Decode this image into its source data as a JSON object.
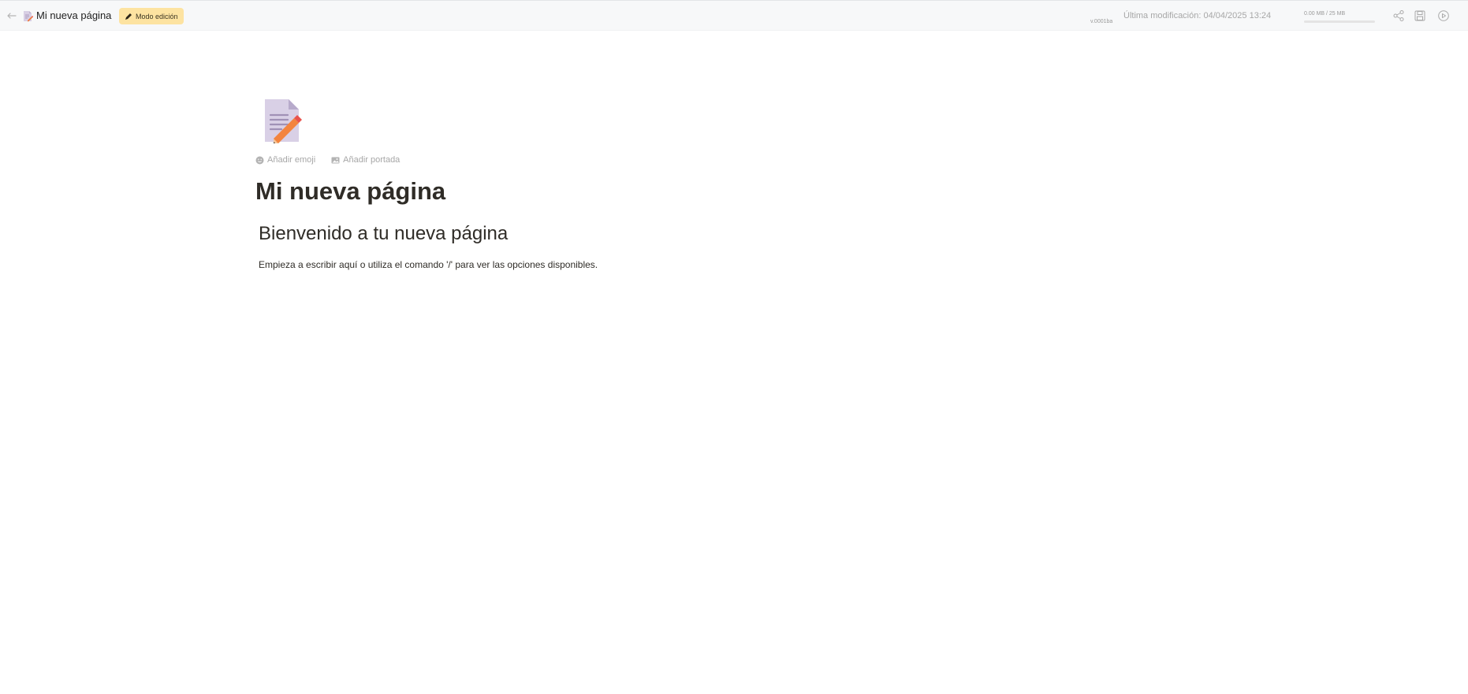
{
  "topbar": {
    "back_icon": "arrow-left-icon",
    "page_icon": "memo-icon",
    "page_title": "Mi nueva página",
    "mode_label": "Modo edición",
    "mode_icon": "pencil-icon",
    "version": "v.0001ba",
    "last_modified": "Última modificación: 04/04/2025 13:24",
    "storage_text": "0.00 MB / 25 MB",
    "storage_used_fraction": 0,
    "share_icon": "share-icon",
    "save_icon": "save-icon",
    "play_icon": "play-icon"
  },
  "page": {
    "icon": "memo-icon",
    "add_emoji_label": "Añadir emoji",
    "add_cover_label": "Añadir portada",
    "title": "Mi nueva página",
    "heading": "Bienvenido a tu nueva página",
    "paragraph": "Empieza a escribir aquí o utiliza el comando '/' para ver las opciones disponibles."
  },
  "colors": {
    "mode_badge_bg": "#fde3a1",
    "topbar_bg": "#f7f8f9",
    "muted_text": "#a7a7a7"
  }
}
